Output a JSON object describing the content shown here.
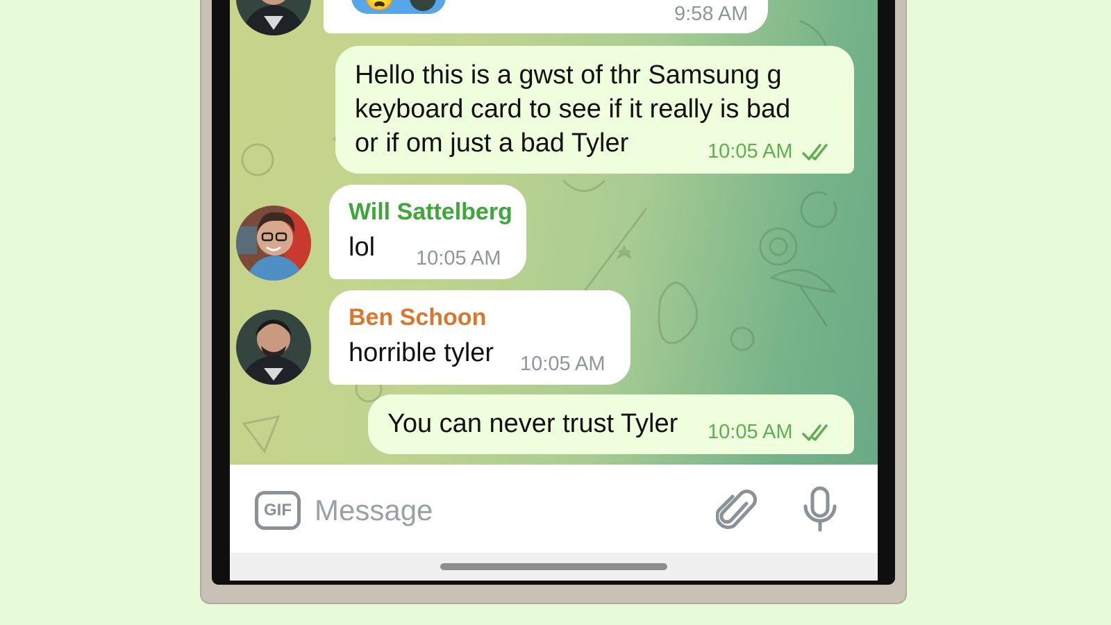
{
  "colors": {
    "page_bg": "#e7fbd9",
    "incoming_bubble": "#ffffff",
    "outgoing_bubble": "#effedd",
    "outgoing_time": "#5fae52",
    "incoming_time": "#8d969a",
    "sender_will": "#3ea63a",
    "sender_ben": "#d9782c",
    "icon_gray": "#8a9297"
  },
  "messages": [
    {
      "direction": "in",
      "time": "9:58 AM",
      "avatar": "avatar-ben",
      "partial": true
    },
    {
      "direction": "out",
      "lines": [
        "Hello this is a gwst of thr Samsung g",
        "keyboard card to see if it really is bad",
        "or if om just a bad Tyler"
      ],
      "time": "10:05 AM",
      "status_icon": "double-check-icon"
    },
    {
      "direction": "in",
      "sender": "Will Sattelberg",
      "text": "lol",
      "time": "10:05 AM",
      "avatar": "avatar-will"
    },
    {
      "direction": "in",
      "sender": "Ben Schoon",
      "text": "horrible tyler",
      "time": "10:05 AM",
      "avatar": "avatar-ben"
    },
    {
      "direction": "out",
      "text": "You can never trust Tyler",
      "time": "10:05 AM",
      "status_icon": "double-check-icon"
    }
  ],
  "input_bar": {
    "gif_label": "GIF",
    "placeholder": "Message",
    "attach_icon": "paperclip-icon",
    "mic_icon": "microphone-icon"
  }
}
